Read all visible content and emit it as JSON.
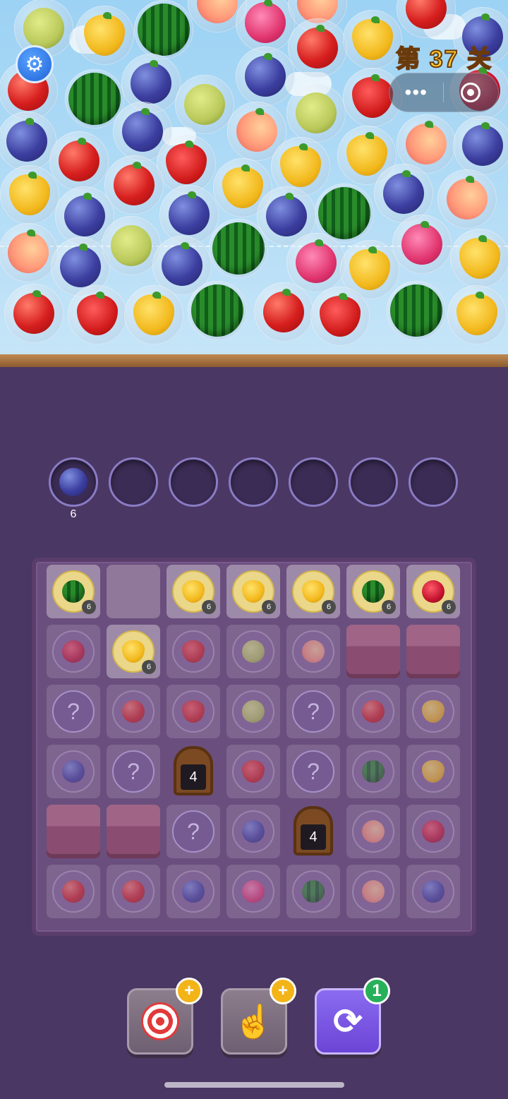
{
  "hud": {
    "settings_icon": "gear-icon",
    "level": "第 37 关",
    "more_label": "•••",
    "close_icon": "target-icon"
  },
  "colors": {
    "sky": "#b4ddf6",
    "board_bg": "#6a4e7e",
    "page_bg": "#4a3763",
    "level_text": "#ffcf30",
    "badge_yellow": "#f3b417",
    "badge_green": "#27b05a"
  },
  "collector": {
    "slots": [
      {
        "fruit": "blueberry",
        "count": "6"
      },
      {
        "fruit": "",
        "count": ""
      },
      {
        "fruit": "",
        "count": ""
      },
      {
        "fruit": "",
        "count": ""
      },
      {
        "fruit": "",
        "count": ""
      },
      {
        "fruit": "",
        "count": ""
      },
      {
        "fruit": "",
        "count": ""
      }
    ]
  },
  "board": {
    "rows": [
      [
        {
          "t": "fruit",
          "fruit": "watermelon",
          "count": "6",
          "active": true
        },
        {
          "t": "empty"
        },
        {
          "t": "fruit",
          "fruit": "pineapple",
          "count": "6",
          "active": true
        },
        {
          "t": "fruit",
          "fruit": "pineapple",
          "count": "6",
          "active": true
        },
        {
          "t": "fruit",
          "fruit": "pineapple",
          "count": "6",
          "active": true
        },
        {
          "t": "fruit",
          "fruit": "watermelon",
          "count": "6",
          "active": true
        },
        {
          "t": "fruit",
          "fruit": "pomegranate",
          "count": "6",
          "active": true
        }
      ],
      [
        {
          "t": "fruit",
          "fruit": "pomegranate"
        },
        {
          "t": "fruit",
          "fruit": "pineapple",
          "count": "6",
          "active": true
        },
        {
          "t": "fruit",
          "fruit": "strawberry"
        },
        {
          "t": "fruit",
          "fruit": "durian"
        },
        {
          "t": "fruit",
          "fruit": "peach"
        },
        {
          "t": "block"
        },
        {
          "t": "block"
        }
      ],
      [
        {
          "t": "question",
          "label": "?"
        },
        {
          "t": "fruit",
          "fruit": "apple"
        },
        {
          "t": "fruit",
          "fruit": "strawberry"
        },
        {
          "t": "fruit",
          "fruit": "durian"
        },
        {
          "t": "question",
          "label": "?"
        },
        {
          "t": "fruit",
          "fruit": "apple"
        },
        {
          "t": "fruit",
          "fruit": "pineapple"
        }
      ],
      [
        {
          "t": "fruit",
          "fruit": "blueberry"
        },
        {
          "t": "question",
          "label": "?"
        },
        {
          "t": "chest",
          "label": "4"
        },
        {
          "t": "fruit",
          "fruit": "strawberry"
        },
        {
          "t": "question",
          "label": "?"
        },
        {
          "t": "fruit",
          "fruit": "watermelon"
        },
        {
          "t": "fruit",
          "fruit": "pineapple"
        }
      ],
      [
        {
          "t": "block"
        },
        {
          "t": "block"
        },
        {
          "t": "question",
          "label": "?"
        },
        {
          "t": "fruit",
          "fruit": "blueberry"
        },
        {
          "t": "chest",
          "label": "4"
        },
        {
          "t": "fruit",
          "fruit": "peach"
        },
        {
          "t": "fruit",
          "fruit": "pomegranate"
        }
      ],
      [
        {
          "t": "fruit",
          "fruit": "apple"
        },
        {
          "t": "fruit",
          "fruit": "apple"
        },
        {
          "t": "fruit",
          "fruit": "blueberry"
        },
        {
          "t": "fruit",
          "fruit": "dragonfruit"
        },
        {
          "t": "fruit",
          "fruit": "watermelon"
        },
        {
          "t": "fruit",
          "fruit": "peach"
        },
        {
          "t": "fruit",
          "fruit": "blueberry"
        }
      ]
    ]
  },
  "boosters": [
    {
      "name": "target-booster",
      "icon": "dart-target-icon",
      "badge": "+"
    },
    {
      "name": "tap-booster",
      "icon": "pointing-hand-icon",
      "badge": "+"
    },
    {
      "name": "shuffle-booster",
      "icon": "refresh-icon",
      "badge": "1"
    }
  ]
}
